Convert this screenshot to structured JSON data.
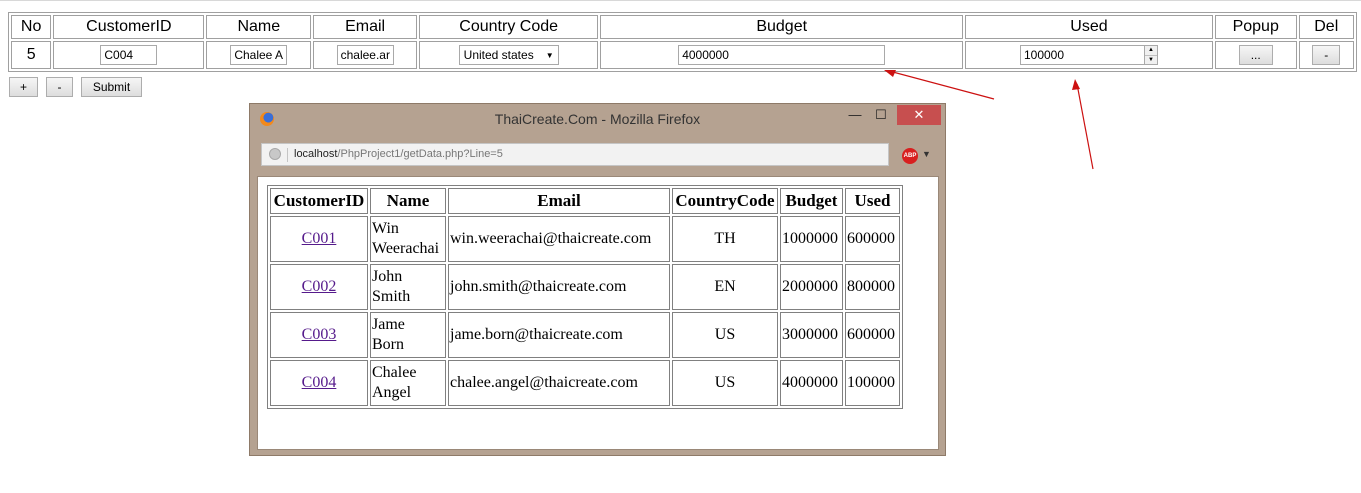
{
  "main_table": {
    "headers": [
      "No",
      "CustomerID",
      "Name",
      "Email",
      "Country Code",
      "Budget",
      "Used",
      "Popup",
      "Del"
    ],
    "row": {
      "no": "5",
      "customer_id": "C004",
      "name": "Chalee A",
      "email": "chalee.ar",
      "country": "United states",
      "budget": "4000000",
      "used": "100000",
      "popup_label": "...",
      "del_label": "-"
    }
  },
  "controls": {
    "add_label": "+",
    "remove_label": "-",
    "submit_label": "Submit"
  },
  "popup_window": {
    "title": "ThaiCreate.Com - Mozilla Firefox",
    "url_host": "localhost",
    "url_path": "/PhpProject1/getData.php?Line=5",
    "abp_label": "ABP",
    "table": {
      "headers": [
        "CustomerID",
        "Name",
        "Email",
        "CountryCode",
        "Budget",
        "Used"
      ],
      "rows": [
        {
          "id": "C001",
          "name1": "Win",
          "name2": "Weerachai",
          "email": "win.weerachai@thaicreate.com",
          "country": "TH",
          "budget": "1000000",
          "used": "600000"
        },
        {
          "id": "C002",
          "name1": "John",
          "name2": "Smith",
          "email": "john.smith@thaicreate.com",
          "country": "EN",
          "budget": "2000000",
          "used": "800000"
        },
        {
          "id": "C003",
          "name1": "Jame",
          "name2": "Born",
          "email": "jame.born@thaicreate.com",
          "country": "US",
          "budget": "3000000",
          "used": "600000"
        },
        {
          "id": "C004",
          "name1": "Chalee",
          "name2": "Angel",
          "email": "chalee.angel@thaicreate.com",
          "country": "US",
          "budget": "4000000",
          "used": "100000"
        }
      ]
    }
  },
  "colors": {
    "arrow": "#cc1111",
    "window_frame": "#b5a291",
    "close_button": "#c74f4f",
    "link": "#551a8b"
  }
}
